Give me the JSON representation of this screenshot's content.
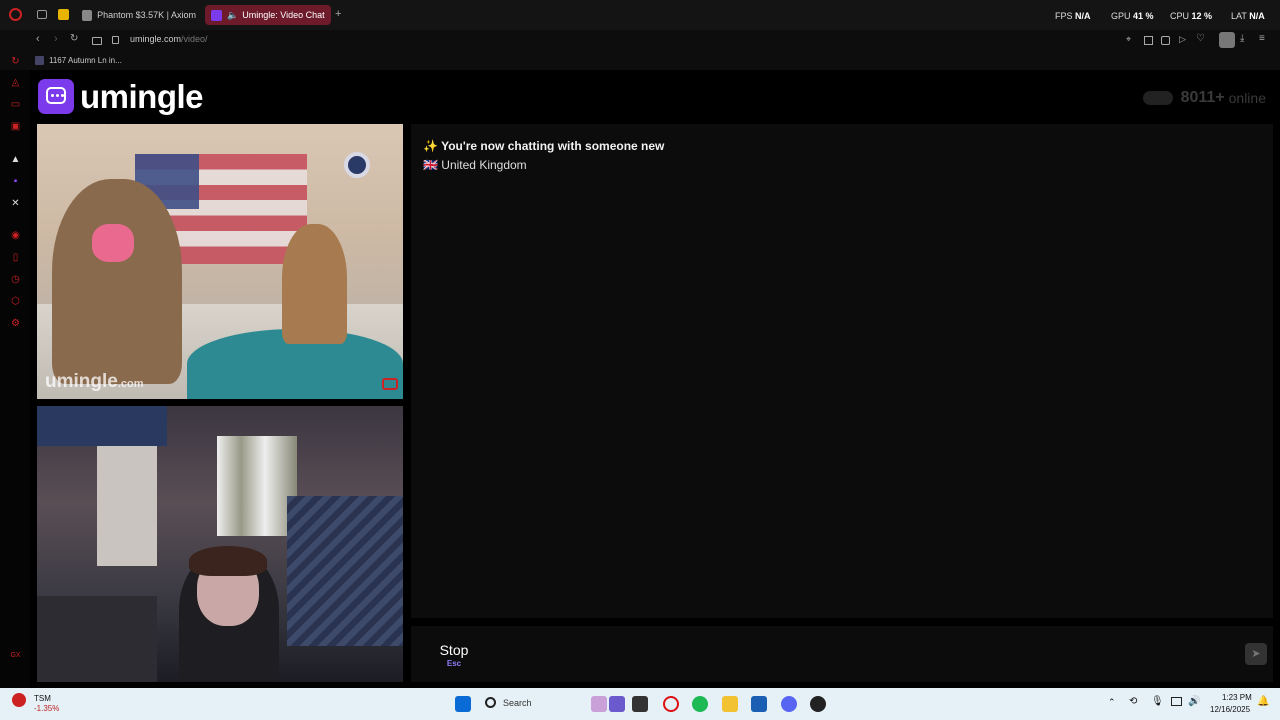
{
  "browser": {
    "tabs": [
      {
        "label": "Phantom $3.57K | Axiom",
        "active": false
      },
      {
        "label": "Umingle: Video Chat",
        "active": true
      }
    ],
    "new_tab_icon": "+",
    "hud": {
      "fps_label": "FPS",
      "fps_value": "N/A",
      "gpu_label": "GPU",
      "gpu_value": "41 %",
      "cpu_label": "CPU",
      "cpu_value": "12 %",
      "lat_label": "LAT",
      "lat_value": "N/A"
    },
    "address": {
      "host": "umingle.com",
      "path": "/video/"
    },
    "bookmark": "1167 Autumn Ln in..."
  },
  "page": {
    "logo_text": "umingle",
    "online_count": "8011+",
    "online_label": "online",
    "remote_watermark": "umingle",
    "remote_watermark_suffix": ".com",
    "chat": {
      "status_icon": "✨",
      "status_text": "You're now chatting with someone new",
      "flag_icon": "🇬🇧",
      "country": "United Kingdom"
    },
    "stop_label": "Stop",
    "stop_key": "Esc"
  },
  "taskbar": {
    "stock_ticker": "TSM",
    "stock_change": "-1.35%",
    "search_label": "Search",
    "time": "1:23 PM",
    "date": "12/16/2025"
  },
  "colors": {
    "brand": "#7c3aed",
    "tab_active": "#6d1a2b",
    "accent_red": "#cc2222"
  }
}
